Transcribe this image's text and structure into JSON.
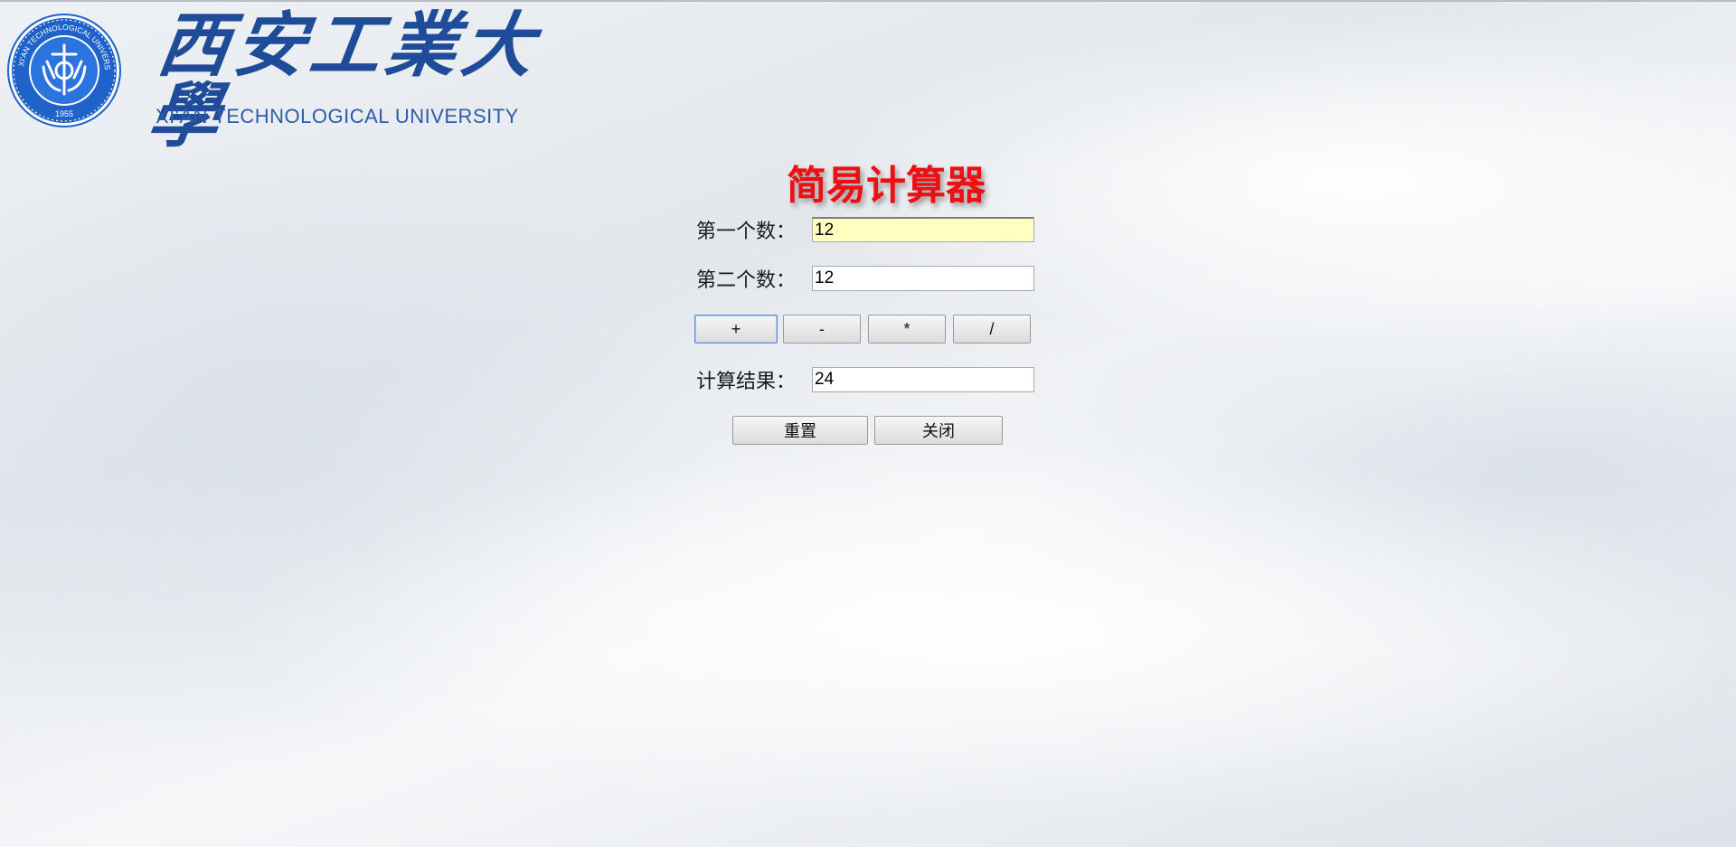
{
  "header": {
    "seal_top_text": "XI'AN TECHNOLOGICAL UNIVERSITY",
    "seal_year": "1955",
    "brand_cn": "西安工業大學",
    "brand_en": "XI'AN TECHNOLOGICAL UNIVERSITY",
    "brand_color": "#1f4c98"
  },
  "calculator": {
    "title": "简易计算器",
    "title_color": "#ee0f12",
    "first_label": "第一个数：",
    "first_value": "12",
    "second_label": "第二个数：",
    "second_value": "12",
    "ops": [
      "+",
      "-",
      "*",
      "/"
    ],
    "result_label": "计算结果：",
    "result_value": "24",
    "reset_label": "重置",
    "close_label": "关闭"
  }
}
